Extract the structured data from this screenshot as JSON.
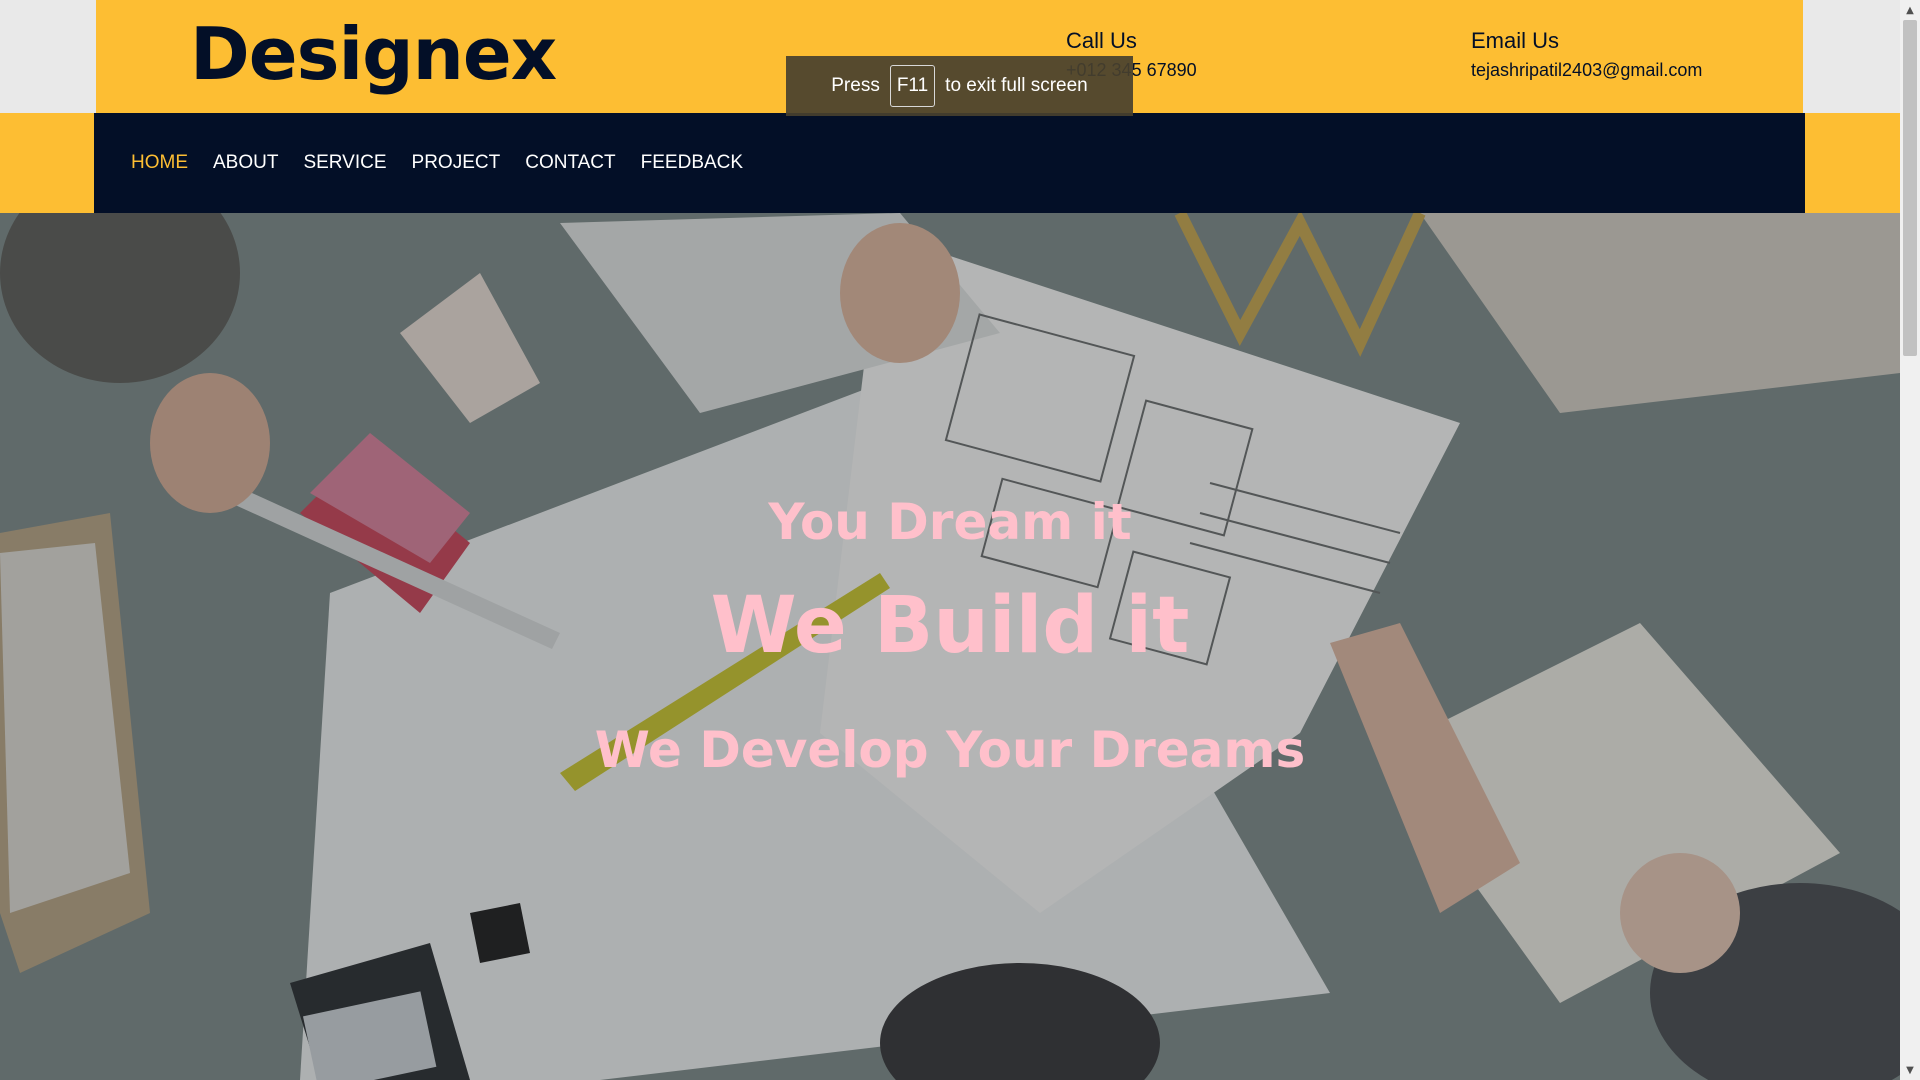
{
  "brand": {
    "logo_text": "Designex"
  },
  "contact": {
    "call": {
      "heading": "Call Us",
      "value": "+012 345 67890"
    },
    "email": {
      "heading": "Email Us",
      "value": "tejashripatil2403@gmail.com"
    }
  },
  "nav": {
    "items": [
      {
        "label": "HOME",
        "active": true
      },
      {
        "label": "ABOUT"
      },
      {
        "label": "SERVICE"
      },
      {
        "label": "PROJECT"
      },
      {
        "label": "CONTACT"
      },
      {
        "label": "FEEDBACK"
      }
    ]
  },
  "hero": {
    "line1": "You Dream it",
    "line2": "We Build it",
    "line3": "We Develop Your Dreams"
  },
  "fullscreen_notice": {
    "prefix": "Press",
    "key": "F11",
    "suffix": "to exit full screen"
  },
  "colors": {
    "accent": "#fdbe33",
    "nav_bg": "#030f27",
    "hero_text": "#ffc0cb"
  },
  "icons": {
    "scroll_up": "scroll-up-arrow-icon",
    "scroll_down": "scroll-down-arrow-icon"
  }
}
